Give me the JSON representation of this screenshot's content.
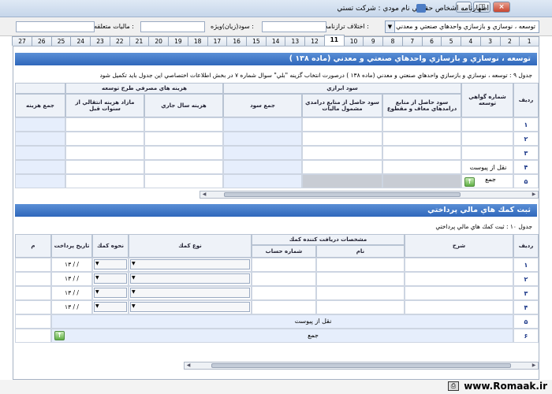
{
  "window": {
    "title": "اظهارنامه اشخاص حقوقي    نام مودي : شركت تستي"
  },
  "infobar": {
    "section_dropdown": "توسعه ، نوسازي و بازسازي واحدهاي صنعتي و معدني",
    "ekhtelaf_label": "اختلاف ترازنامه :",
    "sood_label": "سود(زيان)ويژه :",
    "maliat_label": "ماليات متعلقه :"
  },
  "tabs": [
    "1",
    "2",
    "3",
    "4",
    "5",
    "6",
    "7",
    "8",
    "9",
    "10",
    "11",
    "12",
    "13",
    "14",
    "15",
    "16",
    "17",
    "18",
    "19",
    "20",
    "21",
    "22",
    "23",
    "24",
    "25",
    "26",
    "27"
  ],
  "active_tab": "11",
  "section1": {
    "title": "توسعه ، نوسازي و بازسازي واحدهاي صنعتي و معدني (ماده ١٣٨ )",
    "note": "جدول ٩ : توسعه ، نوسازي و بازسازي واحدهاي صنعتي و معدني (ماده ١٣٨ )  درصورت انتخاب گزينه \"بلي\" سوال شماره ٧ در بخش اطلاعات اختصاصي اين جدول بايد تكميل شود",
    "headers": {
      "radif": "رديف",
      "shomare": "شماره گواهي توسعه",
      "sood_ebrazi": "سود ابرازي",
      "sood_moaf": "سود حاصل از منابع درامدهاي معاف و مقطوع",
      "sood_mashmool": "سود حاصل از منابع درامدي مشمول ماليات",
      "jam_sood": "جمع سود",
      "hazine": "هزينه هاي مصرفي طرح توسعه",
      "hazine_jari": "هزينه سال جاري",
      "mazad": "مازاد هزينه انتقالي از سنوات قبل",
      "jam_hazine": "جمع هزينه"
    },
    "rows": [
      "١",
      "٢",
      "٣",
      "۴",
      "۵"
    ],
    "naghl": "نقل از پيوست",
    "jam": "جمع"
  },
  "section2": {
    "title": "ثبت كمك هاي مالي پرداختي",
    "note": "جدول ١٠ : ثبت كمك هاي مالي پرداختي",
    "headers": {
      "radif": "رديف",
      "sharh": "شرح",
      "moshakhasat": "مشخصات دريافت كننده كمك",
      "nam": "نام",
      "shomare_hesab": "شماره حساب",
      "noe_komak": "نوع كمك",
      "nahve_komak": "نحوه كمك",
      "tarikh": "تاريخ پرداخت",
      "mablagh": "م"
    },
    "rows": [
      "١",
      "٢",
      "٣",
      "۴",
      "۵",
      "۶"
    ],
    "date_value": "١٣ /  /",
    "naghl": "نقل از پيوست",
    "jam": "جمع"
  },
  "footer": {
    "brand": "www.Romaak.ir"
  }
}
